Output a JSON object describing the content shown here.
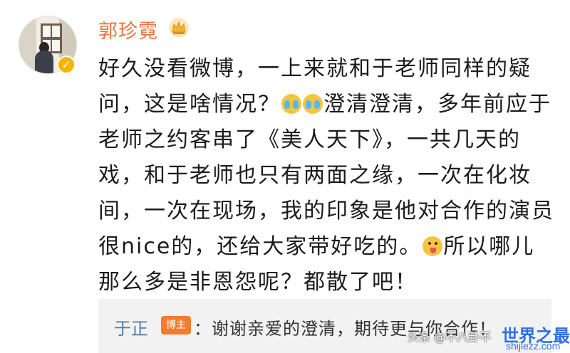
{
  "post": {
    "username": "郭珍霓",
    "text_parts": [
      "好久没看微博，一上来就和于老师同样的疑问，这是啥情况？",
      "澄清澄清，多年前应于老师之约客串了《美人天下》，一共几天的戏，和于老师也只有两面之缘，一次在化妆间，一次在现场，我的印象是他对合作的演员很nice的，还给大家带好吃的。",
      "所以哪儿那么多是非恩怨呢？都散了吧！"
    ],
    "icons": {
      "crown": "crown-icon",
      "verified": "verified-badge-icon",
      "emoji_cry": "crying-laughing-emoji",
      "emoji_tongue": "tongue-out-emoji"
    }
  },
  "comment": {
    "username": "于正",
    "badge": "博主",
    "text": "：谢谢亲爱的澄清，期待更与你合作！"
  },
  "watermark": {
    "source": "头条 @不八卦不",
    "brand": "世界之最",
    "url": "shijiezz.com"
  },
  "colors": {
    "username": "#eb7340",
    "comment_user": "#4b7bb3",
    "badge_bg": "#f57b2f",
    "verified": "#f7b500"
  }
}
